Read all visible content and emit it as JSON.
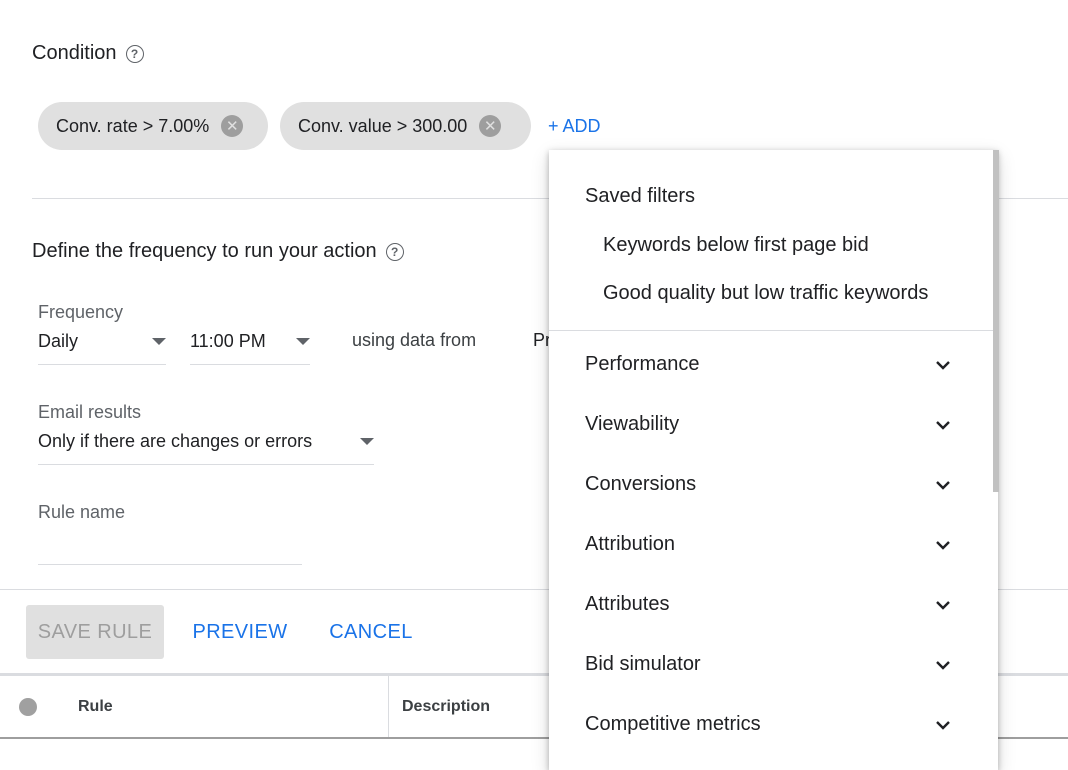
{
  "condition": {
    "title": "Condition",
    "help_glyph": "?",
    "chips": [
      {
        "label": "Conv. rate > 7.00%",
        "close_glyph": "✕"
      },
      {
        "label": "Conv. value > 300.00",
        "close_glyph": "✕"
      }
    ],
    "add_label": "+ ADD"
  },
  "frequency_section": {
    "title": "Define the frequency to run your action",
    "help_glyph": "?",
    "frequency_label": "Frequency",
    "frequency_value": "Daily",
    "time_value": "11:00 PM",
    "using_data_from": "using data from",
    "data_range_partial": "Pr"
  },
  "email": {
    "label": "Email results",
    "value": "Only if there are changes or errors"
  },
  "rule_name": {
    "label": "Rule name",
    "value": ""
  },
  "actions": {
    "save": "SAVE RULE",
    "preview": "PREVIEW",
    "cancel": "CANCEL"
  },
  "table": {
    "columns": [
      "Rule",
      "Description"
    ]
  },
  "dropdown": {
    "saved_filters_heading": "Saved filters",
    "saved_filters": [
      "Keywords below first page bid",
      "Good quality but low traffic keywords"
    ],
    "categories": [
      "Performance",
      "Viewability",
      "Conversions",
      "Attribution",
      "Attributes",
      "Bid simulator",
      "Competitive metrics"
    ]
  },
  "colors": {
    "accent": "#1a73e8",
    "chip_bg": "#e0e0e0",
    "text": "#202124",
    "muted": "#5f6368"
  }
}
